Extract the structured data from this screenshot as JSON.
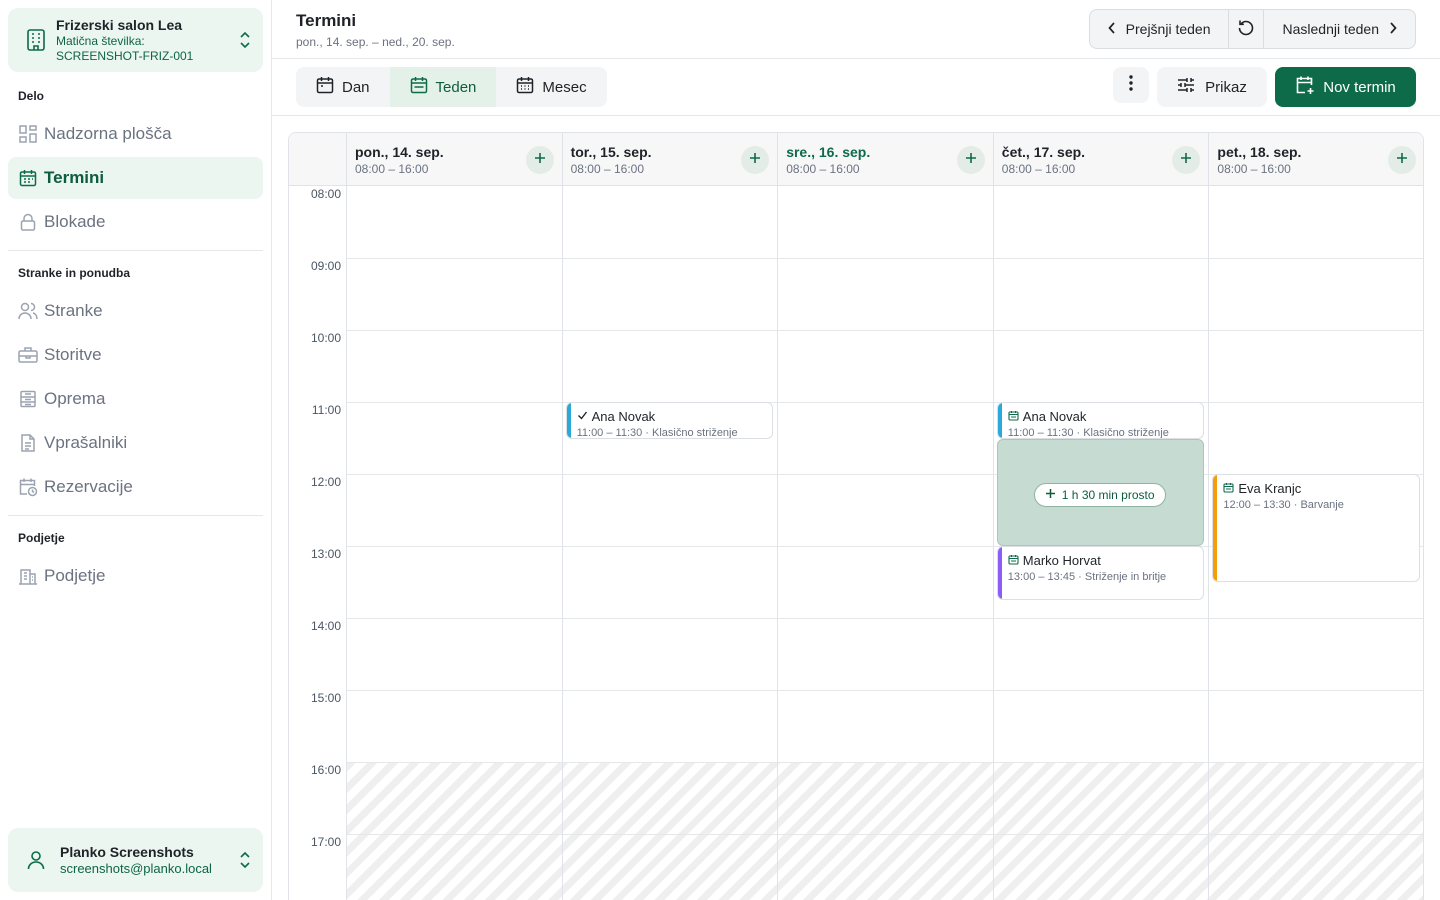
{
  "org": {
    "name": "Frizerski salon Lea",
    "id_label": "Matična številka:",
    "id_value": "SCREENSHOT-FRIZ-001"
  },
  "nav": {
    "groups": [
      {
        "label": "Delo",
        "items": [
          {
            "label": "Nadzorna plošča",
            "icon": "dashboard-icon"
          },
          {
            "label": "Termini",
            "icon": "calendar-icon",
            "active": true
          },
          {
            "label": "Blokade",
            "icon": "lock-icon"
          }
        ]
      },
      {
        "label": "Stranke in ponudba",
        "items": [
          {
            "label": "Stranke",
            "icon": "users-icon"
          },
          {
            "label": "Storitve",
            "icon": "briefcase-icon"
          },
          {
            "label": "Oprema",
            "icon": "equipment-icon"
          },
          {
            "label": "Vprašalniki",
            "icon": "document-icon"
          },
          {
            "label": "Rezervacije",
            "icon": "calendar-clock-icon"
          }
        ]
      },
      {
        "label": "Podjetje",
        "items": [
          {
            "label": "Podjetje",
            "icon": "building-icon"
          }
        ]
      }
    ]
  },
  "user": {
    "name": "Planko Screenshots",
    "email": "screenshots@planko.local"
  },
  "header": {
    "title": "Termini",
    "subtitle": "pon., 14. sep. – ned., 20. sep.",
    "prev_label": "Prejšnji teden",
    "next_label": "Naslednji teden"
  },
  "toolbar": {
    "views": [
      {
        "label": "Dan"
      },
      {
        "label": "Teden",
        "active": true
      },
      {
        "label": "Mesec"
      }
    ],
    "display_label": "Prikaz",
    "new_label": "Nov termin"
  },
  "calendar": {
    "days": [
      {
        "title": "pon., 14. sep.",
        "hours": "08:00 – 16:00"
      },
      {
        "title": "tor., 15. sep.",
        "hours": "08:00 – 16:00"
      },
      {
        "title": "sre., 16. sep.",
        "hours": "08:00 – 16:00",
        "today": true
      },
      {
        "title": "čet., 17. sep.",
        "hours": "08:00 – 16:00"
      },
      {
        "title": "pet., 18. sep.",
        "hours": "08:00 – 16:00"
      }
    ],
    "hours": [
      "08:00",
      "09:00",
      "10:00",
      "11:00",
      "12:00",
      "13:00",
      "14:00",
      "15:00",
      "16:00",
      "17:00"
    ],
    "events": [
      {
        "day": 1,
        "name": "Ana Novak",
        "meta": "11:00 – 11:30 · Klasično striženje",
        "status_icon": "check-icon",
        "color": "#2aa8d8",
        "start": 11.0,
        "end": 11.5
      },
      {
        "day": 3,
        "name": "Ana Novak",
        "meta": "11:00 – 11:30 · Klasično striženje",
        "status_icon": "calendar-icon",
        "color": "#2aa8d8",
        "start": 11.0,
        "end": 11.5
      },
      {
        "day": 3,
        "name": "Marko Horvat",
        "meta": "13:00 – 13:45 · Striženje in britje",
        "status_icon": "calendar-icon",
        "color": "#8b5cf6",
        "start": 13.0,
        "end": 13.75
      },
      {
        "day": 4,
        "name": "Eva Kranjc",
        "meta": "12:00 – 13:30 · Barvanje",
        "status_icon": "calendar-icon",
        "color": "#f59e0b",
        "start": 12.0,
        "end": 13.5
      }
    ],
    "free_slot": {
      "day": 3,
      "label": "1 h 30 min prosto",
      "start": 11.5,
      "end": 13.0
    }
  }
}
